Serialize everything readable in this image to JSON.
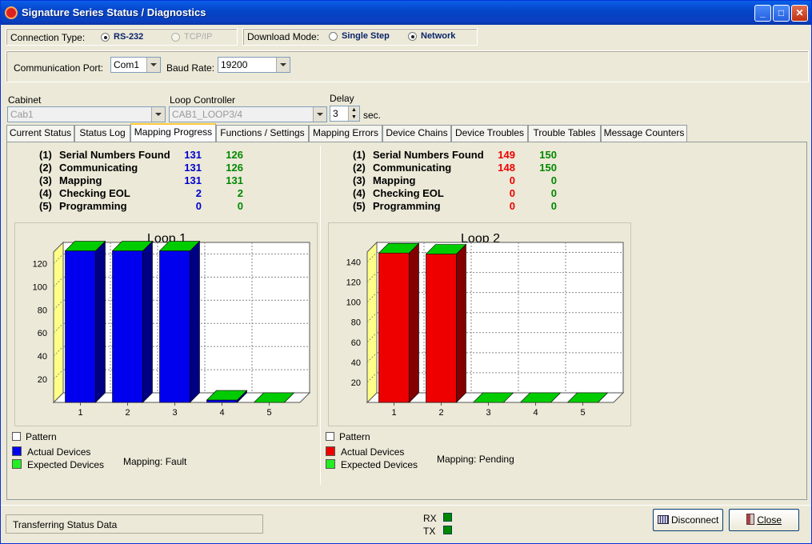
{
  "window": {
    "title": "Signature Series Status / Diagnostics"
  },
  "connection": {
    "label": "Connection Type:",
    "rs232": "RS-232",
    "tcpip": "TCP/IP"
  },
  "download": {
    "label": "Download Mode:",
    "single_step": "Single Step",
    "network": "Network"
  },
  "comm": {
    "port_label": "Communication Port:",
    "port_value": "Com1",
    "baud_label": "Baud Rate:",
    "baud_value": "19200"
  },
  "cabinet": {
    "label": "Cabinet",
    "value": "Cab1"
  },
  "loop_controller": {
    "label": "Loop Controller",
    "value": "CAB1_LOOP3/4"
  },
  "delay": {
    "label": "Delay",
    "value": "3",
    "unit": "sec."
  },
  "tabs": [
    "Current Status",
    "Status Log",
    "Mapping Progress",
    "Functions / Settings",
    "Mapping Errors",
    "Device Chains",
    "Device Troubles",
    "Trouble Tables",
    "Message Counters"
  ],
  "stats_labels": [
    {
      "num": "(1)",
      "text": "Serial Numbers Found"
    },
    {
      "num": "(2)",
      "text": "Communicating"
    },
    {
      "num": "(3)",
      "text": "Mapping"
    },
    {
      "num": "(4)",
      "text": "Checking EOL"
    },
    {
      "num": "(5)",
      "text": "Programming"
    }
  ],
  "loop1_stats": {
    "actual": [
      "131",
      "131",
      "131",
      "2",
      "0"
    ],
    "expected": [
      "126",
      "126",
      "131",
      "2",
      "0"
    ]
  },
  "loop2_stats": {
    "actual": [
      "149",
      "148",
      "0",
      "0",
      "0"
    ],
    "expected": [
      "150",
      "150",
      "0",
      "0",
      "0"
    ]
  },
  "loop1": {
    "title": "Loop 1",
    "mapping": "Mapping: Fault"
  },
  "loop2": {
    "title": "Loop 2",
    "mapping": "Mapping: Pending"
  },
  "legend": {
    "pattern": "Pattern",
    "actual": "Actual Devices",
    "expected": "Expected Devices"
  },
  "colors": {
    "loop1_actual": "#0000ee",
    "loop2_actual": "#ee0000",
    "expected": "#00cc00",
    "wall": "#ffff88"
  },
  "chart_data": [
    {
      "type": "bar",
      "title": "Loop 1",
      "categories": [
        "1",
        "2",
        "3",
        "4",
        "5"
      ],
      "values": [
        131,
        131,
        131,
        2,
        0
      ],
      "ylim": [
        0,
        130
      ],
      "yticks": [
        20,
        40,
        60,
        80,
        100,
        120
      ]
    },
    {
      "type": "bar",
      "title": "Loop 2",
      "categories": [
        "1",
        "2",
        "3",
        "4",
        "5"
      ],
      "values": [
        149,
        148,
        0,
        0,
        0
      ],
      "ylim": [
        0,
        150
      ],
      "yticks": [
        20,
        40,
        60,
        80,
        100,
        120,
        140
      ]
    }
  ],
  "status": {
    "text": "Transferring Status Data",
    "rx": "RX",
    "tx": "TX"
  },
  "buttons": {
    "disconnect": "Disconnect",
    "close": "Close"
  }
}
